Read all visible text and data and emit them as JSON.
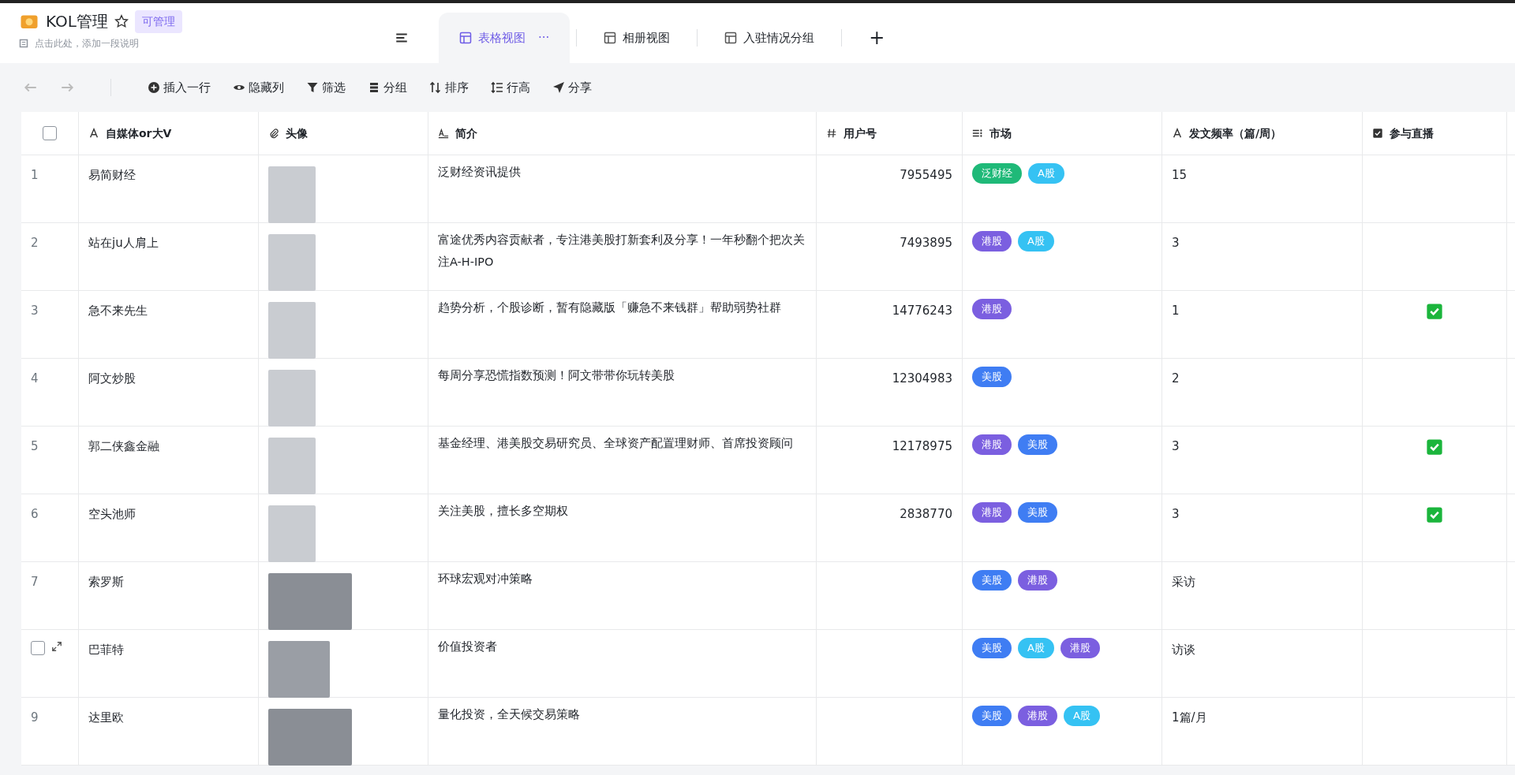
{
  "header": {
    "title": "KOL管理",
    "badge": "可管理",
    "description": "点击此处，添加一段说明"
  },
  "tabs": [
    {
      "label": "表格视图",
      "selected": true,
      "more": "···"
    },
    {
      "label": "相册视图",
      "selected": false
    },
    {
      "label": "入驻情况分组",
      "selected": false
    }
  ],
  "add_tab": "+",
  "toolbar": [
    {
      "label": "插入一行",
      "kind": "insert"
    },
    {
      "label": "隐藏列",
      "kind": "eye"
    },
    {
      "label": "筛选",
      "kind": "filter"
    },
    {
      "label": "分组",
      "kind": "group"
    },
    {
      "label": "排序",
      "kind": "sort"
    },
    {
      "label": "行高",
      "kind": "height"
    },
    {
      "label": "分享",
      "kind": "share"
    }
  ],
  "table": {
    "select_all": {
      "checked": false
    },
    "columns": [
      {
        "label": "自媒体or大V",
        "kind": "text"
      },
      {
        "label": "头像",
        "kind": "attach"
      },
      {
        "label": "简介",
        "kind": "longtext"
      },
      {
        "label": "用户号",
        "kind": "number"
      },
      {
        "label": "市场",
        "kind": "multi"
      },
      {
        "label": "发文频率（篇/周）",
        "kind": "text"
      },
      {
        "label": "参与直播",
        "kind": "check"
      }
    ],
    "rows": [
      {
        "kind": "numbered",
        "number": "1",
        "name": "易简财经",
        "avatar": {
          "kind": "square"
        },
        "intro": "泛财经资讯提供",
        "user_id": "7955495",
        "markets": [
          {
            "label": "泛财经",
            "color": "#1fb978"
          },
          {
            "label": "A股",
            "color": "#35c2f3"
          }
        ],
        "frequency": "15",
        "live": false
      },
      {
        "kind": "numbered",
        "number": "2",
        "name": "站在ju人肩上",
        "avatar": {
          "kind": "square"
        },
        "intro": "富途优秀内容贡献者，专注港美股打新套利及分享！一年秒翻个把次关注A-H-IPO",
        "user_id": "7493895",
        "markets": [
          {
            "label": "港股",
            "color": "#7b5fe0"
          },
          {
            "label": "A股",
            "color": "#35c2f3"
          }
        ],
        "frequency": "3",
        "live": false
      },
      {
        "kind": "numbered",
        "number": "3",
        "name": "急不来先生",
        "avatar": {
          "kind": "square"
        },
        "intro": "趋势分析，个股诊断，暂有隐藏版「赚急不来钱群」帮助弱势社群",
        "user_id": "14776243",
        "markets": [
          {
            "label": "港股",
            "color": "#7b5fe0"
          }
        ],
        "frequency": "1",
        "live": true
      },
      {
        "kind": "numbered",
        "number": "4",
        "name": "阿文炒股",
        "avatar": {
          "kind": "square"
        },
        "intro": "每周分享恐慌指数预测！阿文带带你玩转美股",
        "user_id": "12304983",
        "markets": [
          {
            "label": "美股",
            "color": "#3f7df3"
          }
        ],
        "frequency": "2",
        "live": false
      },
      {
        "kind": "numbered",
        "number": "5",
        "name": "郭二侠鑫金融",
        "avatar": {
          "kind": "square"
        },
        "intro": "基金经理、港美股交易研究员、全球资产配置理财师、首席投资顾问",
        "user_id": "12178975",
        "markets": [
          {
            "label": "港股",
            "color": "#7b5fe0"
          },
          {
            "label": "美股",
            "color": "#3f7df3"
          }
        ],
        "frequency": "3",
        "live": true
      },
      {
        "kind": "numbered",
        "number": "6",
        "name": "空头池师",
        "avatar": {
          "kind": "square"
        },
        "intro": "关注美股，擅长多空期权",
        "user_id": "2838770",
        "markets": [
          {
            "label": "港股",
            "color": "#7b5fe0"
          },
          {
            "label": "美股",
            "color": "#3f7df3"
          }
        ],
        "frequency": "3",
        "live": true
      },
      {
        "kind": "numbered",
        "number": "7",
        "name": "索罗斯",
        "avatar": {
          "kind": "wide"
        },
        "intro": "环球宏观对冲策略",
        "markets": [
          {
            "label": "美股",
            "color": "#3f7df3"
          },
          {
            "label": "港股",
            "color": "#7b5fe0"
          }
        ],
        "frequency": "采访",
        "live": false
      },
      {
        "kind": "hover",
        "checked": false,
        "name": "巴菲特",
        "avatar": {
          "kind": "medium"
        },
        "intro": "价值投资者",
        "markets": [
          {
            "label": "美股",
            "color": "#3f7df3"
          },
          {
            "label": "A股",
            "color": "#35c2f3"
          },
          {
            "label": "港股",
            "color": "#7b5fe0"
          }
        ],
        "frequency": "访谈",
        "live": false
      },
      {
        "kind": "numbered",
        "number": "9",
        "name": "达里欧",
        "avatar": {
          "kind": "wide"
        },
        "intro": "量化投资，全天候交易策略",
        "markets": [
          {
            "label": "美股",
            "color": "#3f7df3"
          },
          {
            "label": "港股",
            "color": "#7b5fe0"
          },
          {
            "label": "A股",
            "color": "#35c2f3"
          }
        ],
        "frequency": "1篇/月",
        "live": false
      }
    ]
  }
}
